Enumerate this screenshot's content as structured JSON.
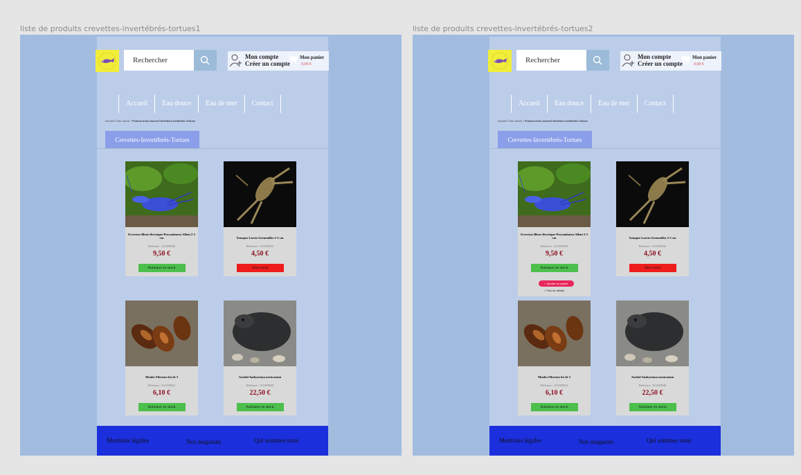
{
  "frames": [
    {
      "title": "liste de produits crevettes-invertébrés-tortues1",
      "expanded_card": false
    },
    {
      "title": "liste de produits crevettes-invertébrés-tortues2",
      "expanded_card": true
    }
  ],
  "header": {
    "search_placeholder": "Rechercher",
    "account_line1": "Mon compte",
    "account_line2": "Créer un compte",
    "cart_label": "Mon panier",
    "cart_amount": "0,00 €"
  },
  "nav": [
    "Accueil",
    "Eau douce",
    "Eau de mer",
    "Contact"
  ],
  "breadcrumb": {
    "path": "Accueil / Eau douce / ",
    "current": "Poisson d'eau douce/Crevettes-Invertébrés-Tortues"
  },
  "category_title": "Crevettes-Invertébrés-Tortues",
  "products": [
    {
      "name": "Ecrevisse Bleue électrique-Procambarus Alleni 2-3 cm",
      "reference": "Référence : 3312509040",
      "price": "9,50 €",
      "stock": "Animaux en stock.",
      "stock_status": "in",
      "image_icon": "blue-crayfish-photo"
    },
    {
      "name": "Xenopus Laevis-Grenouilles 2-3 cm",
      "reference": "Référence : 3312509044",
      "price": "4,50 €",
      "stock": "Hors stock",
      "stock_status": "out",
      "image_icon": "frog-photo"
    },
    {
      "name": "Moules Fibreuse lot de 3",
      "reference": "Référence : 3312509042",
      "price": "6,10 €",
      "stock": "Animaux en stock.",
      "stock_status": "in",
      "image_icon": "mussels-photo"
    },
    {
      "name": "Axolotl Ambystoma mexicanum",
      "reference": "Référence : 3312509048",
      "price": "22,50 €",
      "stock": "Animaux en stock.",
      "stock_status": "in",
      "image_icon": "axolotl-photo"
    }
  ],
  "card_actions": {
    "add_to_cart": "+ Ajouter au panier",
    "more_details": "+ Plus de détails"
  },
  "footer": {
    "legal": "Mentions légales",
    "stores": "Nos magasins",
    "about": "Qui sommes nous"
  },
  "colors": {
    "canvas": "#e5e5e5",
    "frame_bg": "#a2bce0",
    "page_bg": "#bccde9",
    "footer_bg": "#1b2fdc",
    "category_tab": "#8a9ee9",
    "in_stock": "#4cbf4c",
    "out_of_stock": "#ee1c1c",
    "price": "#8b0d1f",
    "add_button": "#e8265a"
  }
}
